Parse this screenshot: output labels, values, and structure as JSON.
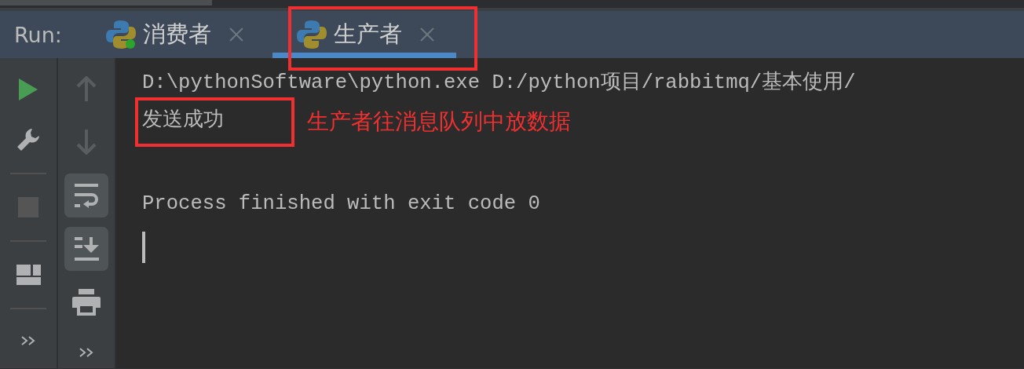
{
  "run_label": "Run:",
  "tabs": [
    {
      "label": "消费者",
      "selected": false,
      "running": true,
      "highlighted": false
    },
    {
      "label": "生产者",
      "selected": true,
      "running": false,
      "highlighted": true
    }
  ],
  "left_toolbar": [
    {
      "kind": "rerun",
      "disabled": false
    },
    {
      "kind": "settings",
      "disabled": false
    },
    {
      "kind": "stop",
      "disabled": true
    },
    {
      "kind": "layout",
      "disabled": false
    },
    {
      "kind": "more",
      "disabled": false
    }
  ],
  "right_toolbar": [
    {
      "kind": "up",
      "on": false,
      "disabled": true
    },
    {
      "kind": "down",
      "on": false,
      "disabled": true
    },
    {
      "kind": "wrap",
      "on": true,
      "disabled": false
    },
    {
      "kind": "scroll-end",
      "on": true,
      "disabled": false
    },
    {
      "kind": "print",
      "on": false,
      "disabled": false
    },
    {
      "kind": "more",
      "on": false,
      "disabled": false
    }
  ],
  "console": {
    "lines": [
      {
        "text": "D:\\pythonSoftware\\python.exe D:/python项目/rabbitmq/基本使用/",
        "highlighted": false
      },
      {
        "text": "发送成功",
        "highlighted": true
      }
    ],
    "exit_message": "Process finished with exit code 0",
    "cursor": true
  },
  "annotation": {
    "text": "生产者往消息队列中放数据"
  }
}
